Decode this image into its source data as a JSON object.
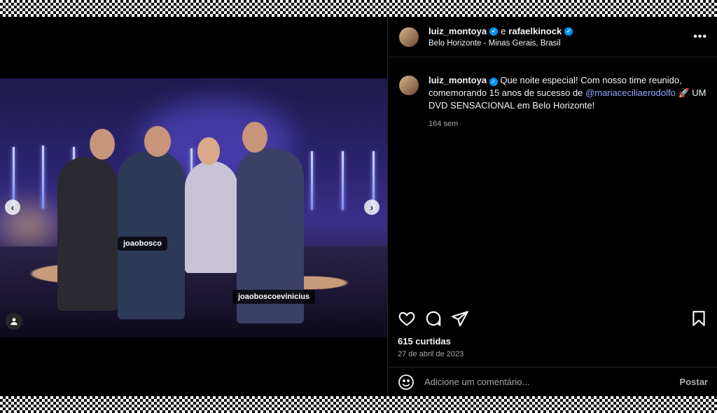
{
  "post": {
    "author": "luiz_montoya",
    "connector": "e",
    "collaborator": "rafaelkinock",
    "location": "Belo Horizonte - Minas Gerais, Brasil",
    "more_label": "•••"
  },
  "caption": {
    "user": "luiz_montoya",
    "text_before": "Que noite especial! Com nosso time reunido, comemorando 15 anos de sucesso de",
    "mention": "@mariaceciliaerodolfo",
    "text_after": "🚀 UM DVD SENSACIONAL em Belo Horizonte!",
    "age": "164 sem"
  },
  "media": {
    "tags": [
      "joaobosco",
      "joaoboscoevinicius"
    ],
    "prev_label": "‹",
    "next_label": "›"
  },
  "stats": {
    "likes": "615 curtidas",
    "date": "27 de abril de 2023"
  },
  "comment": {
    "placeholder": "Adicione um comentário...",
    "post_label": "Postar"
  },
  "icons": [
    "heart-icon",
    "comment-icon",
    "share-icon",
    "bookmark-icon",
    "emoji-icon",
    "verified-icon",
    "user-tag-icon"
  ]
}
